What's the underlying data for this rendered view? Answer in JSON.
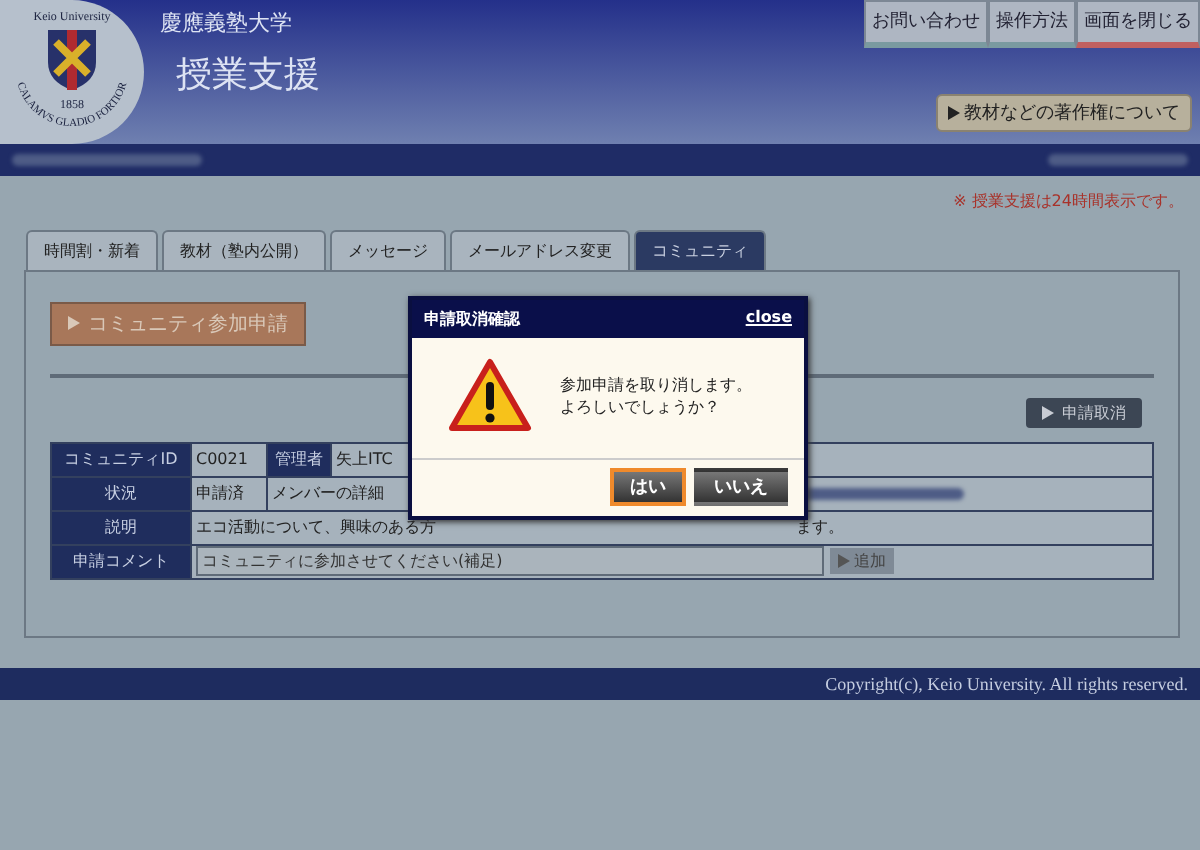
{
  "header": {
    "logo_texts": [
      "Keio University",
      "1858",
      "CALAMVS GLADIO FORTIOR"
    ],
    "university": "慶應義塾大学",
    "title": "授業支援",
    "top_links": [
      "お問い合わせ",
      "操作方法",
      "画面を閉じる"
    ],
    "copyright_button": "教材などの著作権について"
  },
  "notice": "※ 授業支援は24時間表示です。",
  "tabs": [
    {
      "label": "時間割・新着",
      "selected": false
    },
    {
      "label": "教材（塾内公開）",
      "selected": false
    },
    {
      "label": "メッセージ",
      "selected": false
    },
    {
      "label": "メールアドレス変更",
      "selected": false
    },
    {
      "label": "コミュニティ",
      "selected": true
    }
  ],
  "community_button": "コミュニティ参加申請",
  "cancel_button": "申請取消",
  "table": {
    "rows": [
      {
        "label": "コミュニティID",
        "cells": [
          {
            "kind": "value",
            "text": "C0021"
          },
          {
            "kind": "label",
            "text": "管理者"
          },
          {
            "kind": "value",
            "text": "矢上ITC"
          }
        ]
      },
      {
        "label": "状況",
        "cells": [
          {
            "kind": "value",
            "text": "申請済"
          },
          {
            "kind": "value",
            "text": "メンバーの詳細",
            "colspan": 2,
            "blurred": true
          }
        ]
      },
      {
        "label": "説明",
        "cells": [
          {
            "kind": "parts",
            "parts": [
              "エコ活動について、興味のある方",
              "ます。"
            ],
            "colspan": 3
          }
        ]
      },
      {
        "label": "申請コメント",
        "cells": [
          {
            "kind": "input",
            "text": "コミュニティに参加させてください(補足)",
            "button": "追加",
            "colspan": 3
          }
        ]
      }
    ]
  },
  "footer": "Copyright(c), Keio University. All rights reserved.",
  "dialog": {
    "title": "申請取消確認",
    "close": "close",
    "lines": [
      "参加申請を取り消します。",
      "よろしいでしょうか？"
    ],
    "buttons": [
      {
        "label": "はい",
        "selected": true
      },
      {
        "label": "いいえ",
        "selected": false
      }
    ]
  }
}
